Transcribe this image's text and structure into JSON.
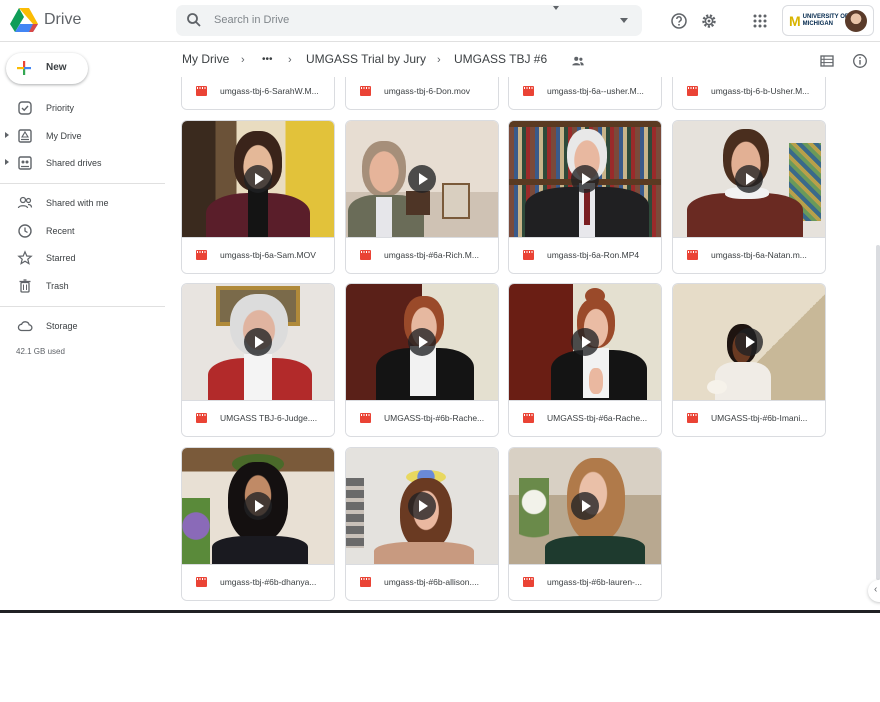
{
  "app": {
    "name": "Drive"
  },
  "search": {
    "placeholder": "Search in Drive"
  },
  "account": {
    "org_line1": "UNIVERSITY OF",
    "org_line2": "MICHIGAN"
  },
  "sidebar": {
    "new_label": "New",
    "items": [
      {
        "label": "Priority",
        "icon": "priority-icon"
      },
      {
        "label": "My Drive",
        "icon": "my-drive-icon"
      },
      {
        "label": "Shared drives",
        "icon": "shared-drives-icon"
      },
      {
        "label": "Shared with me",
        "icon": "shared-with-me-icon"
      },
      {
        "label": "Recent",
        "icon": "clock-icon"
      },
      {
        "label": "Starred",
        "icon": "star-icon"
      },
      {
        "label": "Trash",
        "icon": "trash-icon"
      },
      {
        "label": "Storage",
        "icon": "cloud-icon"
      }
    ],
    "storage_used": "42.1 GB used"
  },
  "breadcrumb": {
    "root": "My Drive",
    "ellipsis": "•••",
    "parent": "UMGASS Trial by Jury",
    "current": "UMGASS TBJ #6"
  },
  "files": [
    {
      "name": "umgass-tbj-6-SarahW.M..."
    },
    {
      "name": "umgass-tbj-6-Don.mov"
    },
    {
      "name": "umgass-tbj-6a--usher.M..."
    },
    {
      "name": "umgass-tbj-6-b-Usher.M..."
    },
    {
      "name": "umgass-tbj-6a-Sam.MOV"
    },
    {
      "name": "umgass-tbj-#6a-Rich.M..."
    },
    {
      "name": "umgass-tbj-6a-Ron.MP4"
    },
    {
      "name": "umgass-tbj-6a-Natan.m..."
    },
    {
      "name": "UMGASS TBJ-6-Judge...."
    },
    {
      "name": "UMGASS-tbj-#6b-Rache..."
    },
    {
      "name": "UMGASS-tbj-#6a-Rache..."
    },
    {
      "name": "UMGASS-tbj-#6b-Imani..."
    },
    {
      "name": "umgass-tbj-#6b-dhanya..."
    },
    {
      "name": "umgass-tbj-#6b-allison...."
    },
    {
      "name": "umgass-tbj-#6b-lauren-..."
    }
  ],
  "colors": {
    "accent": "#1a73e8",
    "video_icon": "#ea4335"
  }
}
